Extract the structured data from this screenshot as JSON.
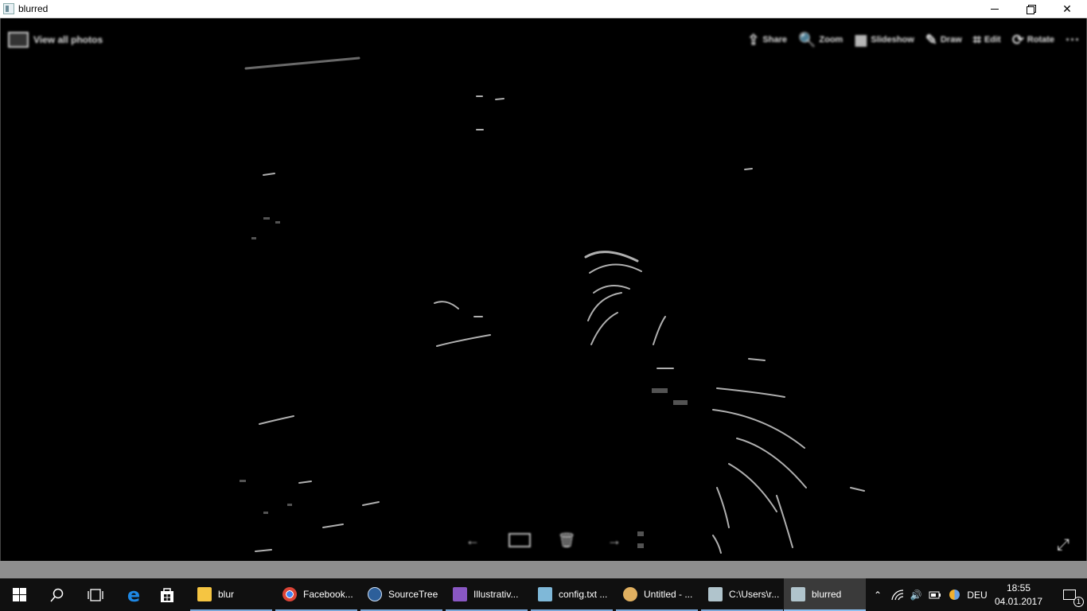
{
  "window": {
    "title": "blurred",
    "minimize_label": "Minimize",
    "restore_label": "Restore",
    "close_label": "Close"
  },
  "viewer": {
    "title_text": "View all photos",
    "toolbar": [
      {
        "icon": "share-icon",
        "glyph": "⇪",
        "label": "Share"
      },
      {
        "icon": "zoom-icon",
        "glyph": "🔍",
        "label": "Zoom"
      },
      {
        "icon": "slideshow-icon",
        "glyph": "▦",
        "label": "Slideshow"
      },
      {
        "icon": "draw-icon",
        "glyph": "✎",
        "label": "Draw"
      },
      {
        "icon": "edit-icon",
        "glyph": "⌗",
        "label": "Edit"
      },
      {
        "icon": "rotate-icon",
        "glyph": "⟳",
        "label": "Rotate"
      },
      {
        "icon": "more-icon",
        "glyph": "···",
        "label": ""
      }
    ],
    "bottom_controls": [
      {
        "icon": "previous-icon",
        "glyph": "←"
      },
      {
        "icon": "film-strip-icon",
        "glyph": ""
      },
      {
        "icon": "delete-icon",
        "glyph": "🗑"
      },
      {
        "icon": "next-icon",
        "glyph": "→"
      }
    ],
    "expand_glyph": "⤢"
  },
  "taskbar": {
    "apps": [
      {
        "name": "blur",
        "icon": "folder-icon",
        "color": "#f5c542"
      },
      {
        "name": "Facebook...",
        "icon": "chrome-icon",
        "color": "#db4437"
      },
      {
        "name": "SourceTree",
        "icon": "sourcetree-icon",
        "color": "#2d5f9a"
      },
      {
        "name": "Illustrativ...",
        "icon": "visual-studio-icon",
        "color": "#8957c3"
      },
      {
        "name": "config.txt ...",
        "icon": "notepad-icon",
        "color": "#7fb8d8"
      },
      {
        "name": "Untitled - ...",
        "icon": "paint-icon",
        "color": "#e0b060"
      },
      {
        "name": "C:\\Users\\r...",
        "icon": "console-icon",
        "color": "#b0c4cc"
      },
      {
        "name": "blurred",
        "icon": "viewer-icon",
        "color": "#b0c4cc"
      }
    ],
    "language": "DEU",
    "time": "18:55",
    "date": "04.01.2017",
    "notification_count": "1"
  }
}
